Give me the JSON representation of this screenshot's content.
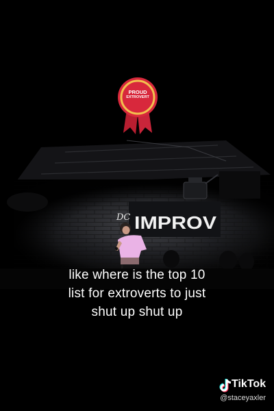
{
  "badge": {
    "line1": "PROUD",
    "line2": "EXTROVERT"
  },
  "sign": {
    "small": "DC",
    "main": "IMPROV"
  },
  "caption": {
    "line1": "like where is the top 10",
    "line2": "list for extroverts to just",
    "line3": "shut up shut up"
  },
  "watermark": {
    "brand": "TikTok",
    "handle": "@staceyaxler",
    "icon": "tiktok-logo-icon"
  },
  "colors": {
    "ribbon": "#d8283c",
    "ribbon_ring": "#f2c14e",
    "stage_wall": "#2a2b2e",
    "caption_text": "#ffffff"
  }
}
